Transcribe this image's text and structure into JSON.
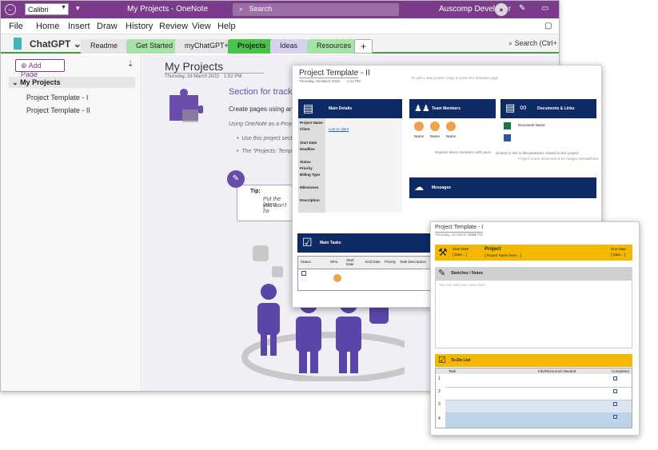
{
  "titlebar": {
    "font": "Calibri",
    "window_title": "My Projects - OneNote",
    "search": "Search",
    "user": "Auscomp Developer"
  },
  "menu": [
    "File",
    "Home",
    "Insert",
    "Draw",
    "History",
    "Review",
    "View",
    "Help"
  ],
  "notebook": {
    "name": "ChatGPT"
  },
  "tabs": [
    {
      "label": "Readme",
      "color": "#e6e6e6"
    },
    {
      "label": "Get Started",
      "color": "#a7e3a7"
    },
    {
      "label": "myChatGPT+",
      "color": "#e6e6e6"
    },
    {
      "label": "Projects",
      "color": "#49c349"
    },
    {
      "label": "Ideas",
      "color": "#d8d0f0"
    },
    {
      "label": "Resources",
      "color": "#a7e3a7"
    }
  ],
  "page_search": "Search (Ctrl+",
  "sidebar": {
    "add_page": "Add Page",
    "section": "My Projects",
    "pages": [
      "Project Template - I",
      "Project Template - II"
    ]
  },
  "page": {
    "title": "My Projects",
    "date": "Thursday, 16 March 2023",
    "time": "1:52 PM",
    "section_heading": "Section for tracking",
    "line1": "Create pages using any of t",
    "line2": "Using OneNote as a Project M",
    "bullet1": "Use this project section",
    "bullet2": "The \"Projects: Template",
    "tip_title": "Tip:",
    "tip_line1": "Put the latest",
    "tip_line2": "you won't ha"
  },
  "template2": {
    "title": "Project Template - II",
    "date": "Thursday, 16 March 2023",
    "time": "1:14 PM",
    "hint": "To add a new project: Copy & paste this template page",
    "main_details": "Main Details",
    "fields": [
      "Project Name",
      "Client",
      "Start Date",
      "Deadline",
      "Status",
      "Priority",
      "Billing Type",
      "Milestones",
      "Description"
    ],
    "client_link": "Link to client",
    "team": "Team Members",
    "member": "Name",
    "team_hint": "Replace demo members with yours",
    "docs": "Documents & Links",
    "doc_name": "Document Name",
    "docs_hint": "Embed or link to files/websites related to this project",
    "docs_hint2": "Project scope document & for budget spreadsheet",
    "messages": "Messages",
    "main_tasks": "Main Tasks",
    "task_cols": [
      "Status",
      "Who",
      "Start Date",
      "End Date",
      "Priority",
      "Task Description"
    ]
  },
  "template1": {
    "title": "Project Template - I",
    "date": "Thursday, 16 March 2023",
    "time": "1:14 PM",
    "start_date": "Start Date",
    "start_ph": "[ Date... ]",
    "project": "Project",
    "project_ph": "[ Project Name here... ]",
    "due_date": "Due Date",
    "due_ph": "[ Date... ]",
    "sketches": "Sketches / Notes",
    "sketch_ph": "You can add your notes here...",
    "todo": "To-Do List",
    "todo_cols": [
      "Task",
      "Info/Resources Needed",
      "Completed"
    ],
    "rows": [
      "1",
      "2",
      "3",
      "4"
    ]
  }
}
